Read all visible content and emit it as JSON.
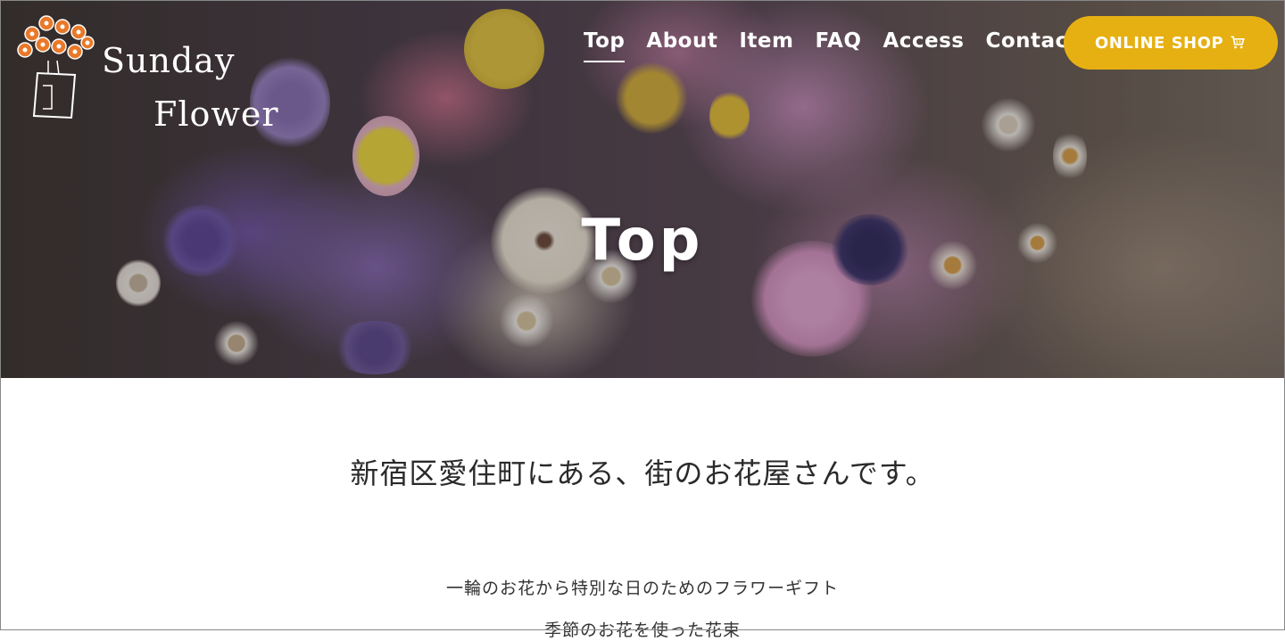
{
  "brand": {
    "line1": "Sunday",
    "line2": "Flower",
    "logo_icon": "flower-vase-icon",
    "logo_color": "#e8792a"
  },
  "nav": {
    "items": [
      {
        "label": "Top",
        "active": true
      },
      {
        "label": "About",
        "active": false
      },
      {
        "label": "Item",
        "active": false
      },
      {
        "label": "FAQ",
        "active": false
      },
      {
        "label": "Access",
        "active": false
      },
      {
        "label": "Contact",
        "active": false
      }
    ],
    "shop_button": {
      "label": "ONLINE SHOP",
      "icon": "cart-icon",
      "color": "#e6b012"
    }
  },
  "hero": {
    "title": "Top"
  },
  "content": {
    "tagline": "新宿区愛住町にある、街のお花屋さんです。",
    "desc1": "一輪のお花から特別な日のためのフラワーギフト",
    "desc2": "季節のお花を使った花束"
  }
}
